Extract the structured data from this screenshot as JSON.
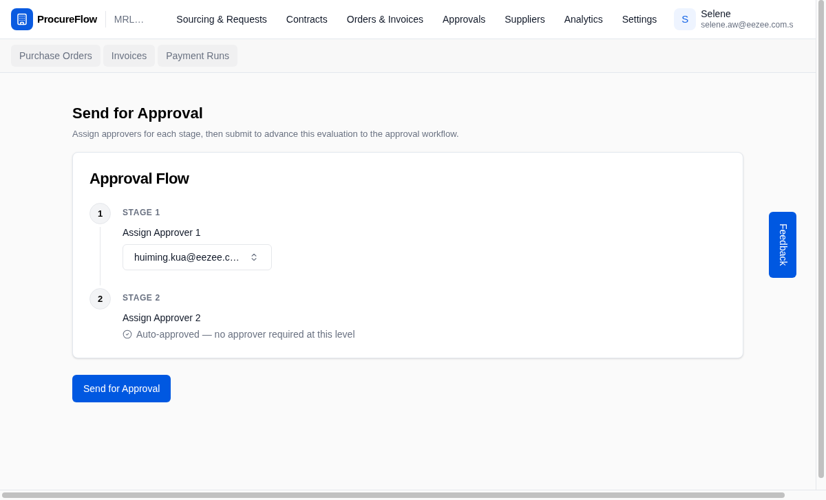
{
  "header": {
    "brand": "ProcureFlow",
    "workspace": "MRL…",
    "nav": [
      {
        "label": "Sourcing & Requests"
      },
      {
        "label": "Contracts"
      },
      {
        "label": "Orders & Invoices"
      },
      {
        "label": "Approvals"
      },
      {
        "label": "Suppliers"
      },
      {
        "label": "Analytics"
      },
      {
        "label": "Settings"
      }
    ],
    "user": {
      "initial": "S",
      "name": "Selene",
      "email": "selene.aw@eezee.com.s"
    }
  },
  "subnav": {
    "tabs": [
      {
        "label": "Purchase Orders"
      },
      {
        "label": "Invoices"
      },
      {
        "label": "Payment Runs"
      }
    ]
  },
  "page": {
    "title": "Send for Approval",
    "subtitle": "Assign approvers for each stage, then submit to advance this evaluation to the approval workflow."
  },
  "approval_flow": {
    "title": "Approval Flow",
    "stages": [
      {
        "number": "1",
        "label": "STAGE 1",
        "field_label": "Assign Approver 1",
        "kind": "select",
        "value": "huiming.kua@eezee.c…"
      },
      {
        "number": "2",
        "label": "STAGE 2",
        "field_label": "Assign Approver 2",
        "kind": "auto",
        "note": "Auto-approved — no approver required at this level"
      }
    ]
  },
  "submit_button": "Send for Approval",
  "feedback_tab": "Feedback"
}
